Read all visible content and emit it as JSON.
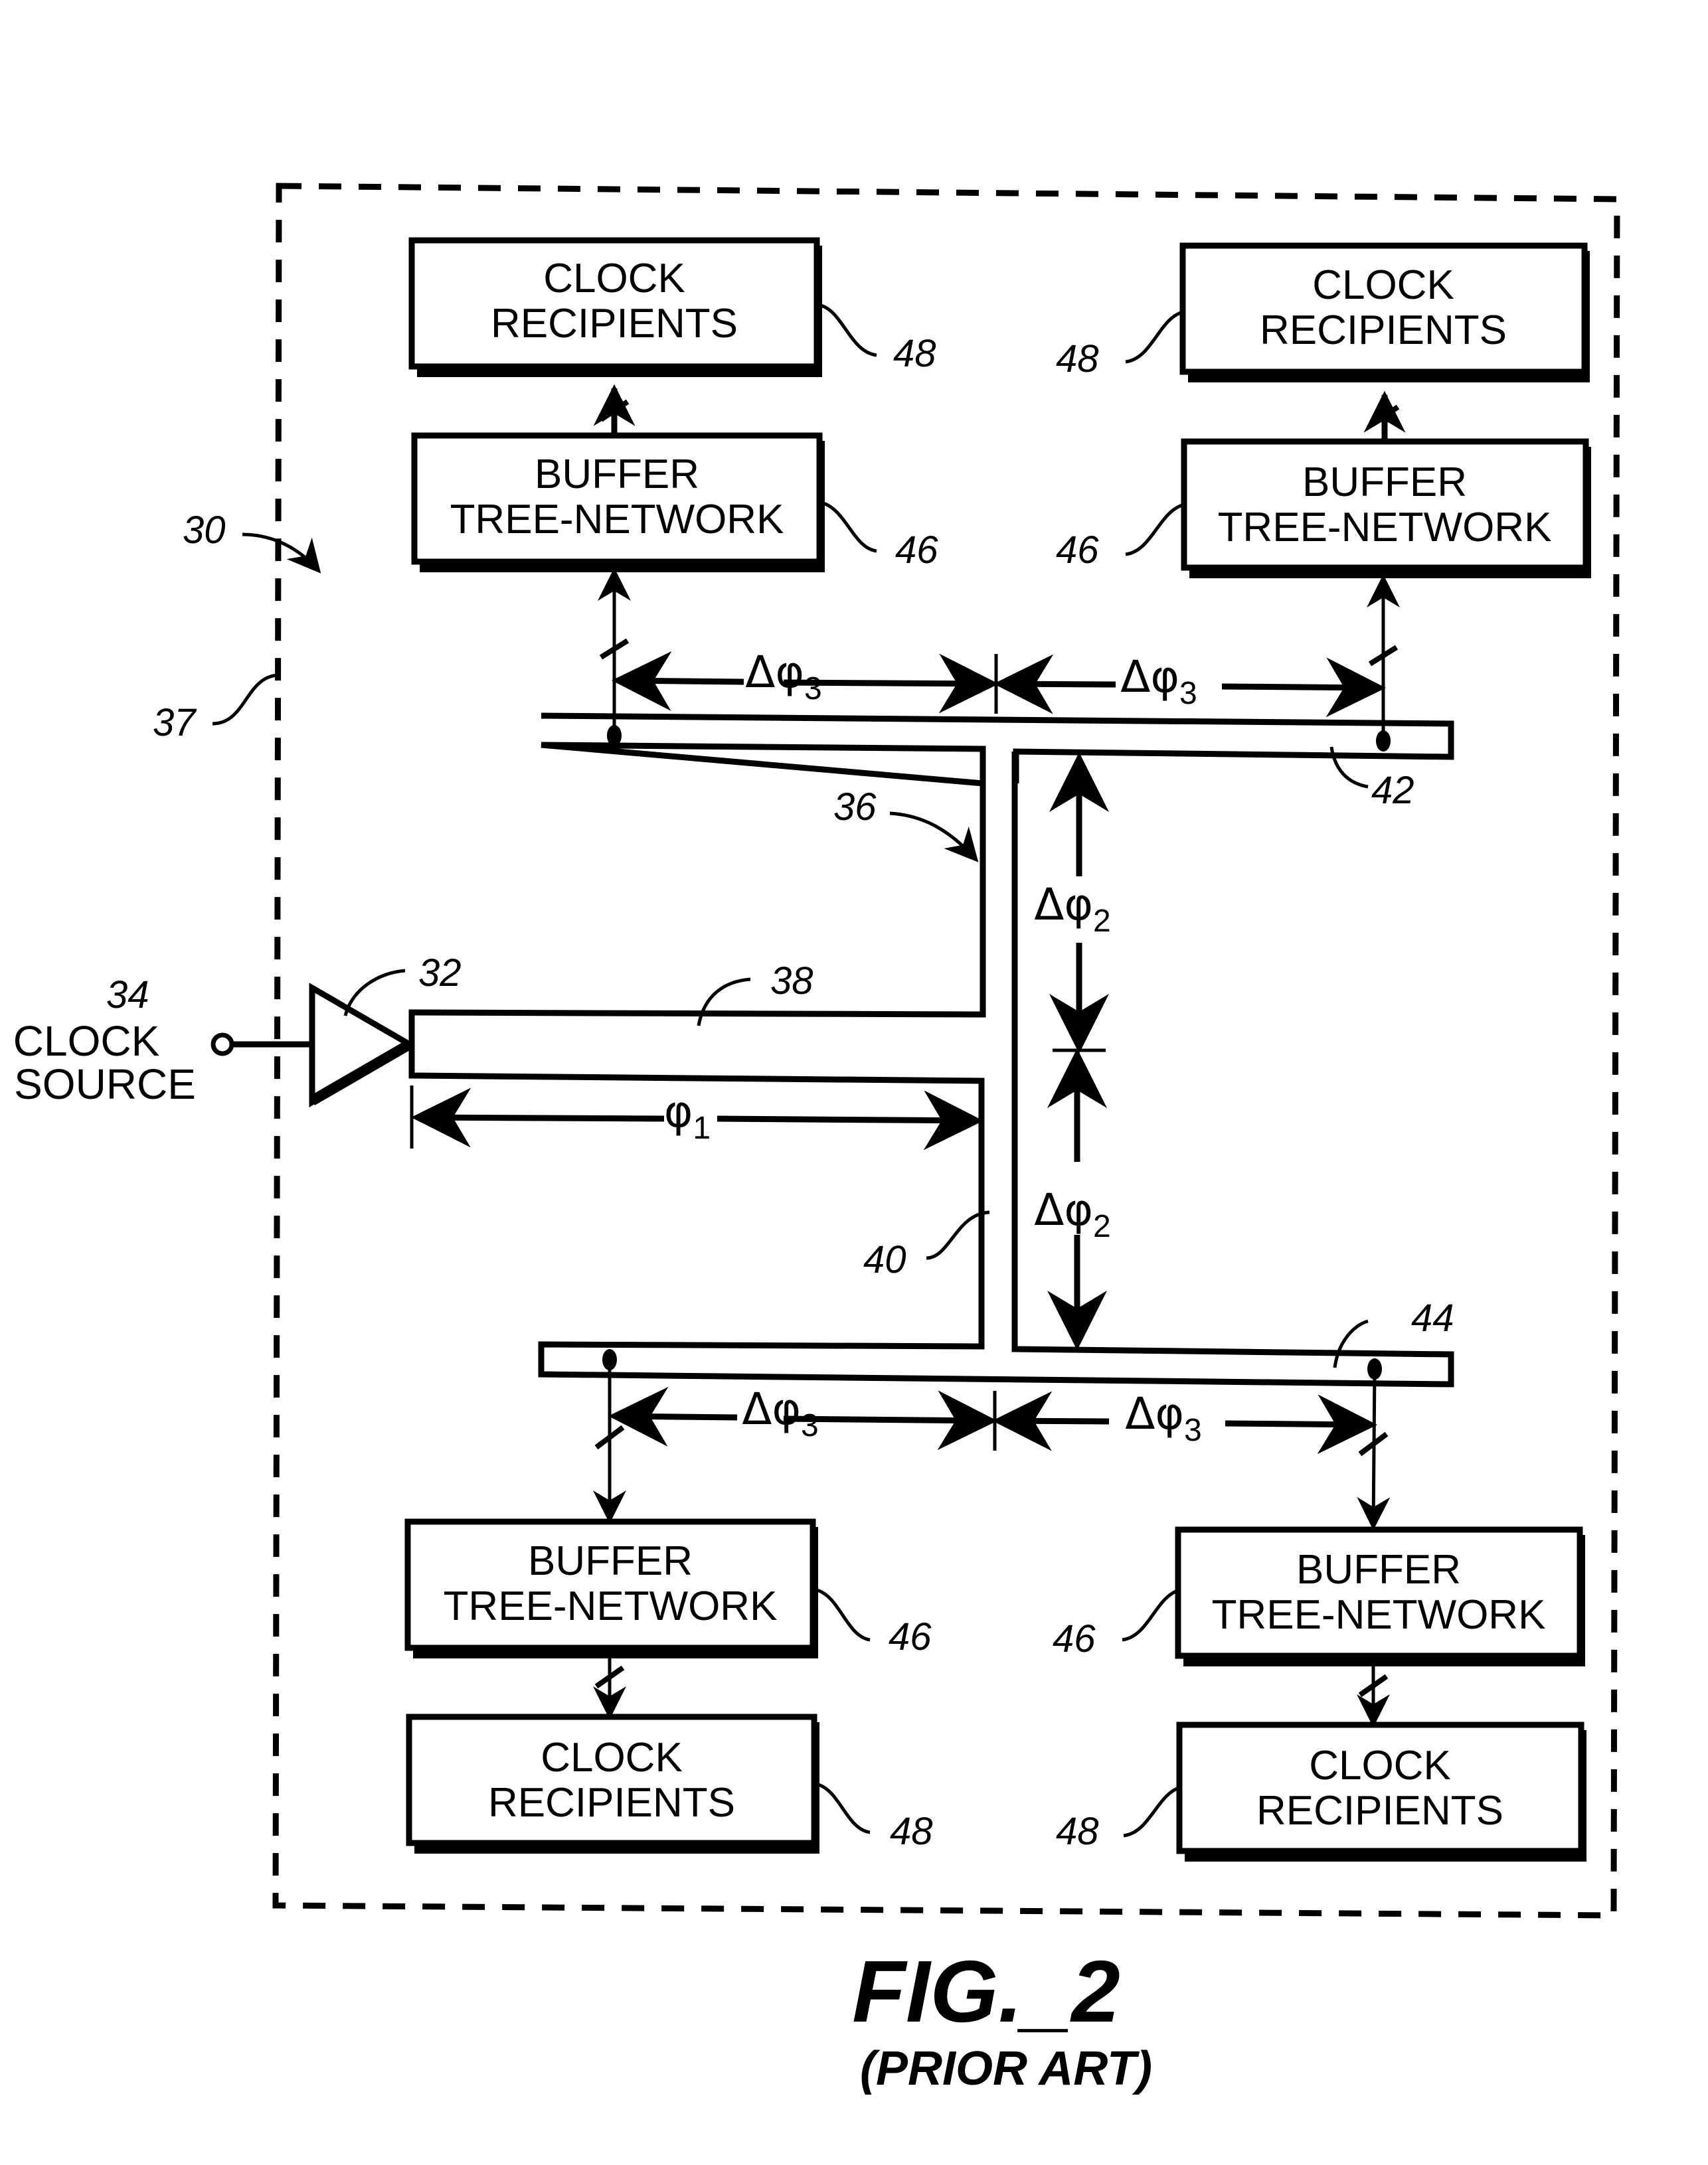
{
  "figure": {
    "title": "FIG._2",
    "subtitle": "(PRIOR ART)"
  },
  "clock_source": {
    "ref": "34",
    "line1": "CLOCK",
    "line2": "SOURCE"
  },
  "reference_labels": {
    "system": "30",
    "driver": "32",
    "h_tree": "36",
    "chip_boundary": "37",
    "trunk_segment": "38",
    "vertical_segment": "40",
    "upper_branch": "42",
    "lower_branch": "44"
  },
  "blocks": [
    {
      "id": "top-left-recipients",
      "line1": "CLOCK",
      "line2": "RECIPIENTS",
      "ref": "48"
    },
    {
      "id": "top-left-buffer",
      "line1": "BUFFER",
      "line2": "TREE-NETWORK",
      "ref": "46"
    },
    {
      "id": "top-right-recipients",
      "line1": "CLOCK",
      "line2": "RECIPIENTS",
      "ref": "48"
    },
    {
      "id": "top-right-buffer",
      "line1": "BUFFER",
      "line2": "TREE-NETWORK",
      "ref": "46"
    },
    {
      "id": "bottom-left-buffer",
      "line1": "BUFFER",
      "line2": "TREE-NETWORK",
      "ref": "46"
    },
    {
      "id": "bottom-left-recipients",
      "line1": "CLOCK",
      "line2": "RECIPIENTS",
      "ref": "48"
    },
    {
      "id": "bottom-right-buffer",
      "line1": "BUFFER",
      "line2": "TREE-NETWORK",
      "ref": "46"
    },
    {
      "id": "bottom-right-recipients",
      "line1": "CLOCK",
      "line2": "RECIPIENTS",
      "ref": "48"
    }
  ],
  "dimensions": {
    "phi1": {
      "symbol": "φ",
      "subscript": "1"
    },
    "dphi2": {
      "symbol": "Δφ",
      "subscript": "2"
    },
    "dphi3": {
      "symbol": "Δφ",
      "subscript": "3"
    }
  }
}
